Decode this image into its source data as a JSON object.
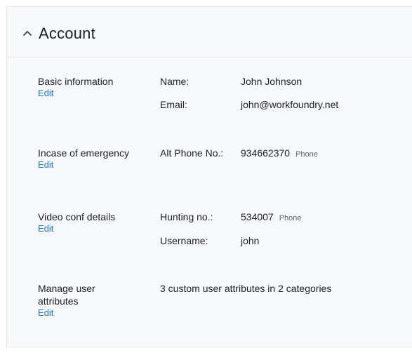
{
  "card": {
    "title": "Account",
    "chevron_icon": "chevron-up-icon"
  },
  "sections": [
    {
      "title": "Basic information",
      "edit_label": "Edit",
      "fields": [
        {
          "label": "Name:",
          "value": "John Johnson"
        },
        {
          "label": "Email:",
          "value": "john@workfoundry.net"
        }
      ]
    },
    {
      "title": "Incase of emergency",
      "edit_label": "Edit",
      "fields": [
        {
          "label": "Alt Phone No.:",
          "value": "934662370",
          "tag": "Phone"
        }
      ]
    },
    {
      "title": "Video conf details",
      "edit_label": "Edit",
      "fields": [
        {
          "label": "Hunting no.:",
          "value": "534007",
          "tag": "Phone"
        },
        {
          "label": "Username:",
          "value": "john"
        }
      ]
    },
    {
      "title_line1": "Manage user",
      "title_line2": "attributes",
      "edit_label": "Edit",
      "summary": "3 custom user attributes in 2 categories"
    }
  ],
  "colors": {
    "link": "#1a73e8",
    "card_background": "#f8f9fa",
    "text": "#202124",
    "tag": "#5f6368"
  }
}
